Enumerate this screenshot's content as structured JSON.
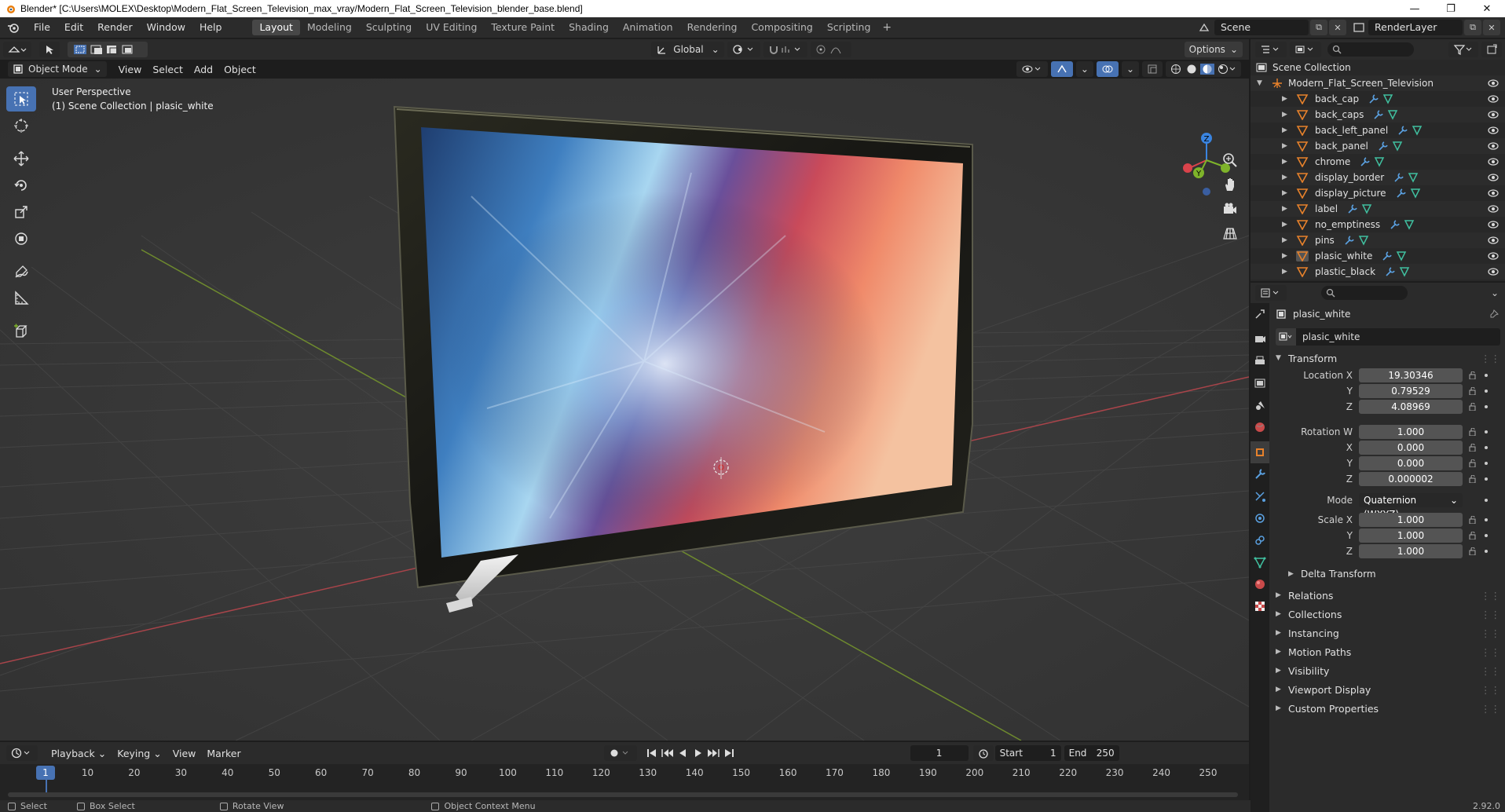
{
  "window": {
    "title": "Blender* [C:\\Users\\MOLEX\\Desktop\\Modern_Flat_Screen_Television_max_vray/Modern_Flat_Screen_Television_blender_base.blend]",
    "minimize": "—",
    "maximize": "❐",
    "close": "✕"
  },
  "menu": {
    "items": [
      "File",
      "Edit",
      "Render",
      "Window",
      "Help"
    ],
    "workspaces": [
      "Layout",
      "Modeling",
      "Sculpting",
      "UV Editing",
      "Texture Paint",
      "Shading",
      "Animation",
      "Rendering",
      "Compositing",
      "Scripting"
    ],
    "add_tab": "+",
    "scene": "Scene",
    "render_layer": "RenderLayer"
  },
  "viewport_header": {
    "transform_orientation": "Global",
    "options": "Options",
    "mode": "Object Mode",
    "menus": [
      "View",
      "Select",
      "Add",
      "Object"
    ]
  },
  "viewport": {
    "perspective": "User Perspective",
    "collection_info": "(1) Scene Collection | plasic_white",
    "gizmo": {
      "x": "X",
      "y": "Y",
      "z": "Z"
    }
  },
  "timeline": {
    "menus": [
      "Playback",
      "Keying",
      "View",
      "Marker"
    ],
    "current_frame": "1",
    "start_label": "Start",
    "start": "1",
    "end_label": "End",
    "end": "250",
    "ruler": [
      "1",
      "10",
      "20",
      "30",
      "40",
      "50",
      "60",
      "70",
      "80",
      "90",
      "100",
      "110",
      "120",
      "130",
      "140",
      "150",
      "160",
      "170",
      "180",
      "190",
      "200",
      "210",
      "220",
      "230",
      "240",
      "250"
    ]
  },
  "statusbar": {
    "items": [
      "Select",
      "Box Select",
      "Rotate View",
      "Object Context Menu"
    ],
    "version": "2.92.0"
  },
  "outliner": {
    "root": "Scene Collection",
    "collection": "Modern_Flat_Screen_Television",
    "objects": [
      "back_cap",
      "back_caps",
      "back_left_panel",
      "back_panel",
      "chrome",
      "display_border",
      "display_picture",
      "label",
      "no_emptiness",
      "pins",
      "plasic_white",
      "plastic_black"
    ],
    "active": "plasic_white"
  },
  "properties": {
    "object_name": "plasic_white",
    "name_field": "plasic_white",
    "transform_label": "Transform",
    "location": {
      "label_x": "Location X",
      "x": "19.30346",
      "label_y": "Y",
      "y": "0.79529",
      "label_z": "Z",
      "z": "4.08969"
    },
    "rotation": {
      "label_w": "Rotation W",
      "w": "1.000",
      "label_x": "X",
      "x": "0.000",
      "label_y": "Y",
      "y": "0.000",
      "label_z": "Z",
      "z": "0.000002"
    },
    "mode_label": "Mode",
    "mode": "Quaternion (WXYZ)",
    "scale": {
      "label_x": "Scale X",
      "x": "1.000",
      "label_y": "Y",
      "y": "1.000",
      "label_z": "Z",
      "z": "1.000"
    },
    "delta_transform": "Delta Transform",
    "panels": [
      "Relations",
      "Collections",
      "Instancing",
      "Motion Paths",
      "Visibility",
      "Viewport Display",
      "Custom Properties"
    ]
  },
  "colors": {
    "accent": "#4772b3",
    "x_axis": "#d9434b",
    "y_axis": "#7eb32a",
    "z_axis": "#3a84e0",
    "object_orange": "#e8822b"
  }
}
